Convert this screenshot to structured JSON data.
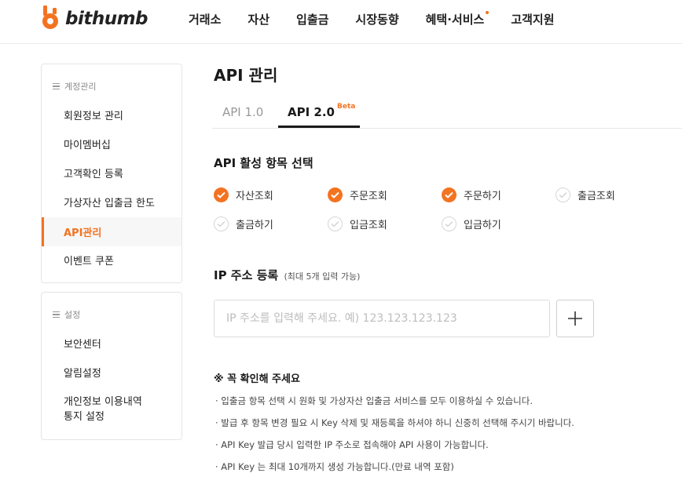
{
  "brand": {
    "name": "bithumb",
    "accent": "#f37321"
  },
  "nav": {
    "items": [
      "거래소",
      "자산",
      "입출금",
      "시장동향",
      "혜택·서비스",
      "고객지원"
    ]
  },
  "sidebar": {
    "account_group": "계정관리",
    "account_items": [
      "회원정보 관리",
      "마이멤버십",
      "고객확인 등록",
      "가상자산 입출금 한도",
      "API관리",
      "이벤트 쿠폰"
    ],
    "active_item": "API관리",
    "settings_group": "설정",
    "settings_items": [
      "보안센터",
      "알림설정"
    ],
    "privacy_line1": "개인정보 이용내역",
    "privacy_line2": "통지 설정"
  },
  "page": {
    "title": "API 관리"
  },
  "tabs": {
    "t1": "API 1.0",
    "t2": "API 2.0",
    "beta": "Beta",
    "active": "API 2.0"
  },
  "permissions": {
    "title": "API 활성 항목 선택",
    "items": [
      {
        "label": "자산조회",
        "checked": true
      },
      {
        "label": "주문조회",
        "checked": true
      },
      {
        "label": "주문하기",
        "checked": true
      },
      {
        "label": "출금조회",
        "checked": false
      },
      {
        "label": "출금하기",
        "checked": false
      },
      {
        "label": "입금조회",
        "checked": false
      },
      {
        "label": "입금하기",
        "checked": false
      }
    ]
  },
  "ip": {
    "title": "IP 주소 등록",
    "subtitle": "(최대 5개 입력 가능)",
    "value": "",
    "placeholder": "IP 주소를 입력해 주세요. 예) 123.123.123.123",
    "add_icon": "plus-icon"
  },
  "notice": {
    "title": "※ 꼭 확인해 주세요",
    "items": [
      "· 입출금 항목 선택 시 원화 및 가상자산 입출금 서비스를 모두 이용하실 수 있습니다.",
      "· 발급 후 항목 변경 필요 시 Key 삭제 및 재등록을 하셔야 하니 신중히 선택해 주시기 바랍니다.",
      "· API Key 발급 당시 입력한 IP 주소로 접속해야 API 사용이 가능합니다.",
      "· API Key 는 최대 10개까지 생성 가능합니다.(만료 내역 포함)"
    ]
  }
}
